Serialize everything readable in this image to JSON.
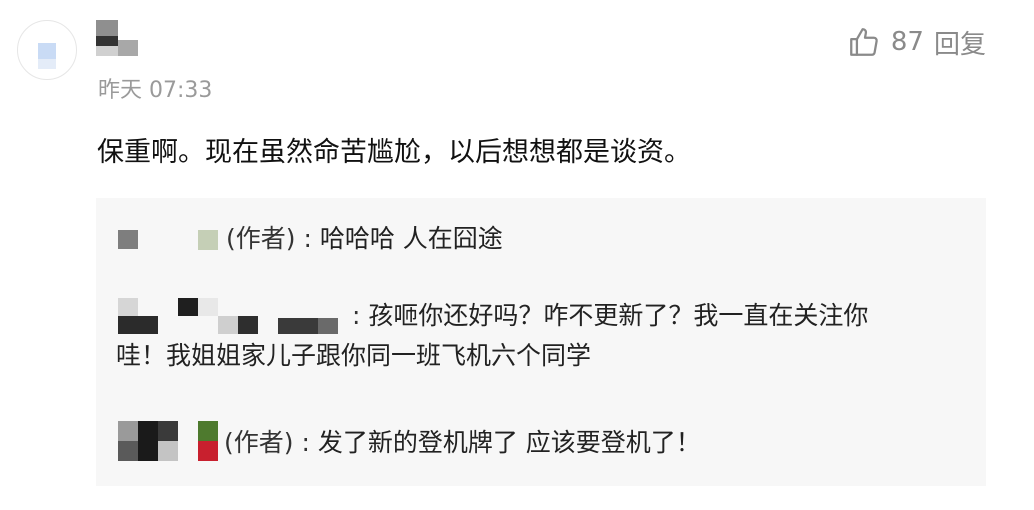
{
  "comment": {
    "timestamp": "昨天 07:33",
    "likes": "87",
    "reply_label": "回复",
    "text": "保重啊。现在虽然命苦尴尬，以后想想都是谈资。"
  },
  "replies": [
    {
      "author_tag": "(作者) : ",
      "text": "哈哈哈  人在囧途"
    },
    {
      "author_tag": " : ",
      "text_line1": "孩咂你还好吗？咋不更新了？我一直在关注你",
      "text_line2": "哇！我姐姐家儿子跟你同一班飞机六个同学"
    },
    {
      "author_tag": "(作者) : ",
      "text": "发了新的登机牌了  应该要登机了！"
    }
  ],
  "colors": {
    "background": "#ffffff",
    "replies_background": "#f7f7f7",
    "meta_text": "#9a9a9a",
    "body_text": "#111111"
  },
  "icons": {
    "like": "thumbs-up-icon"
  }
}
